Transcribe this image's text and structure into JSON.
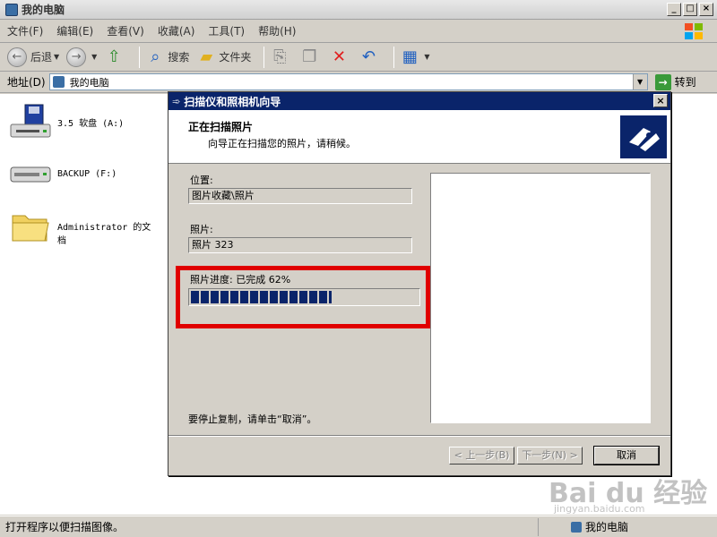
{
  "window": {
    "title": "我的电脑"
  },
  "menu": [
    "文件(F)",
    "编辑(E)",
    "查看(V)",
    "收藏(A)",
    "工具(T)",
    "帮助(H)"
  ],
  "toolbar": {
    "back": "后退",
    "search": "搜索",
    "folders": "文件夹"
  },
  "address": {
    "label": "地址(D)",
    "value": "我的电脑",
    "go": "转到"
  },
  "drives": [
    {
      "label": "3.5 软盘 (A:)",
      "icon": "floppy-drive-icon"
    },
    {
      "label": "BACKUP (F:)",
      "icon": "hard-drive-icon"
    },
    {
      "label": "Administrator 的文档",
      "icon": "folder-icon"
    }
  ],
  "status": {
    "left": "打开程序以便扫描图像。",
    "right": "我的电脑"
  },
  "wizard": {
    "title": "扫描仪和照相机向导",
    "heading": "正在扫描照片",
    "subheading": "向导正在扫描您的照片，请稍候。",
    "location_label": "位置:",
    "location_value": "图片收藏\\照片",
    "photo_label": "照片:",
    "photo_value": "照片 323",
    "progress_label": "照片进度: 已完成 62%",
    "progress_percent": 62,
    "note": "要停止复制，请单击“取消”。",
    "back_button": "< 上一步(B)",
    "next_button": "下一步(N) >",
    "cancel_button": "取消"
  },
  "watermark": {
    "brand": "Bai du 经验",
    "url": "jingyan.baidu.com"
  },
  "colors": {
    "wizard_title": "#0a246a",
    "highlight": "#e00000"
  }
}
